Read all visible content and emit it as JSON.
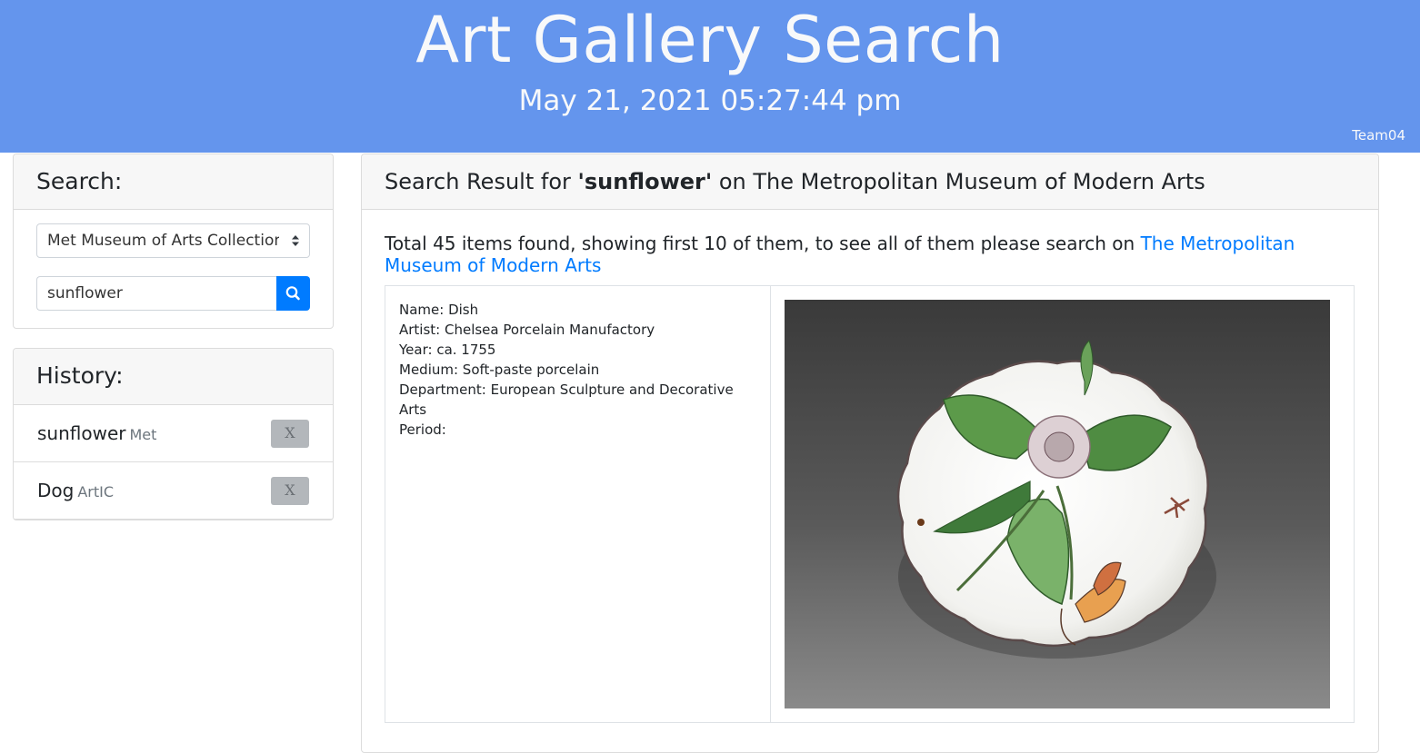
{
  "header": {
    "title": "Art Gallery Search",
    "datetime": "May 21, 2021 05:27:44 pm",
    "team": "Team04"
  },
  "search": {
    "heading": "Search:",
    "collection_selected": "Met Museum of Arts Collection",
    "query_value": "sunflower",
    "button_icon": "search-icon"
  },
  "history": {
    "heading": "History:",
    "items": [
      {
        "term": "sunflower",
        "source": "Met",
        "remove_label": "X"
      },
      {
        "term": "Dog",
        "source": "ArtIC",
        "remove_label": "X"
      }
    ]
  },
  "results": {
    "header_prefix": "Search Result for ",
    "query": "'sunflower'",
    "header_suffix": " on The Metropolitan Museum of Modern Arts",
    "summary_text": "Total 45 items found, showing first 10 of them, to see all of them please search on ",
    "summary_link": "The Metropolitan Museum of Modern Arts",
    "items": [
      {
        "name": "Name: Dish",
        "artist": "Artist: Chelsea Porcelain Manufactory",
        "year": "Year: ca. 1755",
        "medium": "Medium: Soft-paste porcelain",
        "department": "Department: European Sculpture and Decorative Arts",
        "period": "Period:"
      }
    ]
  },
  "colors": {
    "header_bg": "#6495ed",
    "primary": "#007bff",
    "remove_button": "#b3b7bb"
  }
}
